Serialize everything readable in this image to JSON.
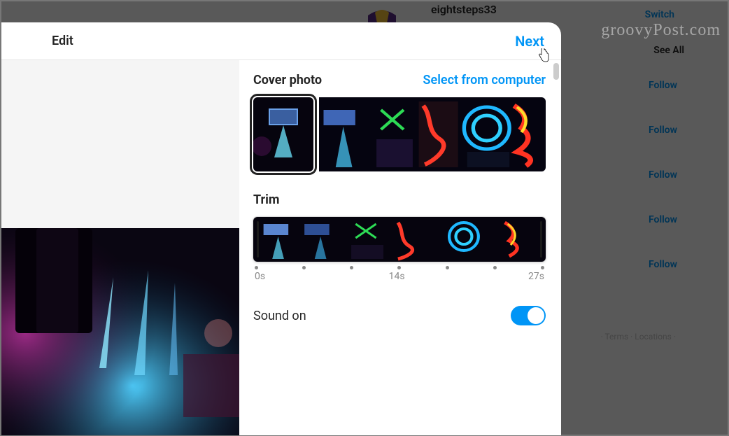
{
  "background": {
    "username": "eightsteps33",
    "switch": "Switch",
    "see_all": "See All",
    "follow": "Follow",
    "footer": "· Terms · Locations ·",
    "watermark": "groovyPost.com"
  },
  "modal": {
    "title": "Edit",
    "next": "Next"
  },
  "cover": {
    "title": "Cover photo",
    "action": "Select from computer"
  },
  "trim": {
    "title": "Trim",
    "start_label": "0s",
    "mid_label": "14s",
    "end_label": "27s"
  },
  "sound": {
    "label": "Sound on",
    "state": true
  }
}
